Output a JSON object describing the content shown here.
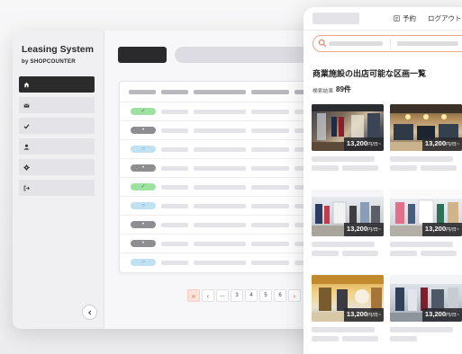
{
  "app": {
    "name": "Leasing System",
    "subtitle": "by SHOPCOUNTER"
  },
  "sidebar": {
    "items": [
      {
        "icon": "home-icon",
        "active": true
      },
      {
        "icon": "mail-icon",
        "active": false
      },
      {
        "icon": "check-icon",
        "active": false
      },
      {
        "icon": "user-icon",
        "active": false
      },
      {
        "icon": "gear-icon",
        "active": false
      },
      {
        "icon": "logout-icon",
        "active": false
      }
    ],
    "collapse_icon": "chevron-left-icon"
  },
  "table": {
    "status_rows": [
      "green",
      "gray",
      "blue",
      "gray",
      "green",
      "blue",
      "gray",
      "gray",
      "blue"
    ],
    "status_glyphs": {
      "green": "✓",
      "gray": "•",
      "blue": "○"
    }
  },
  "pagination": {
    "first": "«",
    "prev": "‹",
    "ellipsis": "...",
    "pages": [
      "3",
      "4",
      "5",
      "6"
    ],
    "next": "›"
  },
  "mobile": {
    "nav_reserve": "予約",
    "nav_logout": "ログアウト",
    "page_title": "商業施設の出店可能な区画一覧",
    "count_label": "検索結果",
    "count_value": "89件",
    "listings": [
      {
        "price": "13,200",
        "unit": "円/日~"
      },
      {
        "price": "13,200",
        "unit": "円/日~"
      },
      {
        "price": "13,200",
        "unit": "円/日~"
      },
      {
        "price": "13,200",
        "unit": "円/日~"
      },
      {
        "price": "13,200",
        "unit": "円/日~"
      },
      {
        "price": "13,200",
        "unit": "円/日~"
      }
    ]
  },
  "colors": {
    "accent": "#e88a6e",
    "sidebar_active": "#2b2b2b",
    "badge_green": "#9ee2a3",
    "badge_gray": "#8d8d92",
    "badge_blue": "#bfe1f2"
  }
}
